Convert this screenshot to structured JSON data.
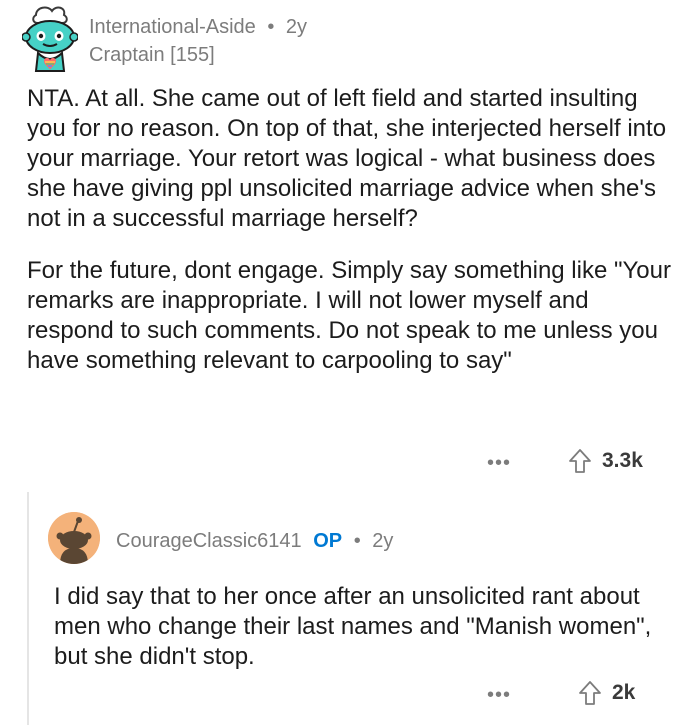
{
  "comment": {
    "username": "International-Aside",
    "age": "2y",
    "flair": "Craptain [155]",
    "paragraphs": [
      "NTA. At all. She came out of left field and started insulting you for no reason. On top of that, she interjected herself into your marriage. Your retort was logical - what business does she have giving ppl unsolicited marriage advice when she's not in a successful marriage herself?",
      "For the future, dont engage. Simply say something like \"Your remarks are inappropriate. I will not lower myself and respond to such comments. Do not speak to me unless you have something relevant to carpooling to say\""
    ],
    "more_label": "•••",
    "upvotes": "3.3k"
  },
  "reply": {
    "username": "CourageClassic6141",
    "op_badge": "OP",
    "age": "2y",
    "text": "I did say that to her once after an unsolicited rant about men who change their last names and \"Manish women\", but she didn't stop.",
    "more_label": "•••",
    "upvotes": "2k"
  },
  "meta": {
    "separator": "•"
  },
  "colors": {
    "text": "#1c1c1c",
    "muted": "#7c7c7c",
    "op_blue": "#0079d3",
    "thread_line": "#e5e5e5",
    "avatar_teal": "#46d1c6",
    "avatar_orange": "#f4b27a"
  },
  "icons": {
    "avatar_1": "snoo-avatar-icon",
    "avatar_2": "default-avatar-icon",
    "upvote": "upvote-arrow-icon",
    "more": "more-options-icon"
  }
}
